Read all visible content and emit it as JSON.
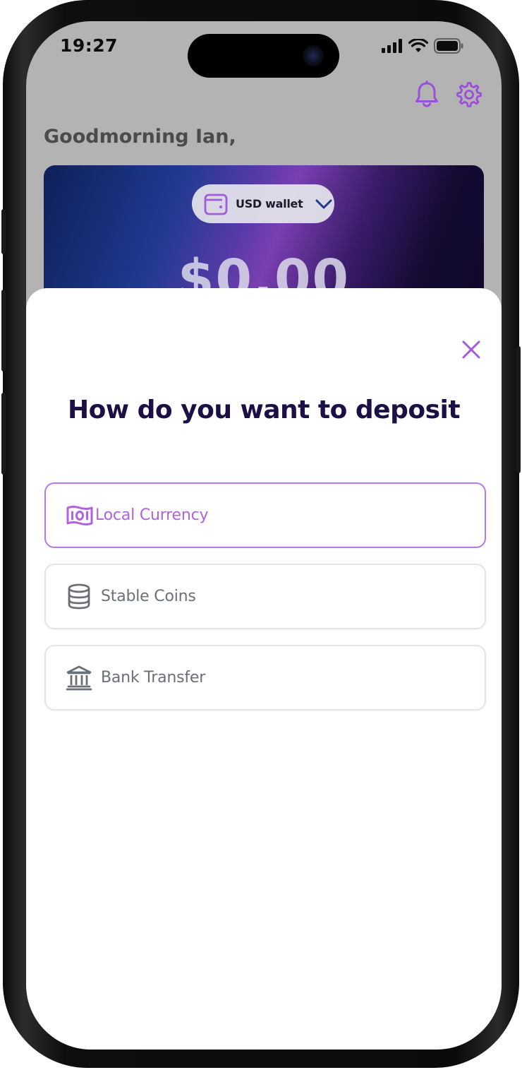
{
  "status_bar": {
    "time": "19:27"
  },
  "header": {
    "greeting": "Goodmorning Ian,",
    "icons": [
      "bell-icon",
      "gear-icon"
    ]
  },
  "wallet": {
    "selector_label": "USD wallet",
    "balance": "$0.00"
  },
  "sheet": {
    "title": "How do you want to deposit",
    "options": [
      {
        "label": "Local Currency",
        "icon": "banknote-icon",
        "selected": true
      },
      {
        "label": "Stable Coins",
        "icon": "coin-stack-icon",
        "selected": false
      },
      {
        "label": "Bank Transfer",
        "icon": "bank-icon",
        "selected": false
      }
    ]
  },
  "colors": {
    "accent": "#b061e6",
    "title": "#1c0f45",
    "muted_text": "#6b6f76",
    "backdrop": "#b3b3b3",
    "header_icon": "#9b4fd8"
  }
}
